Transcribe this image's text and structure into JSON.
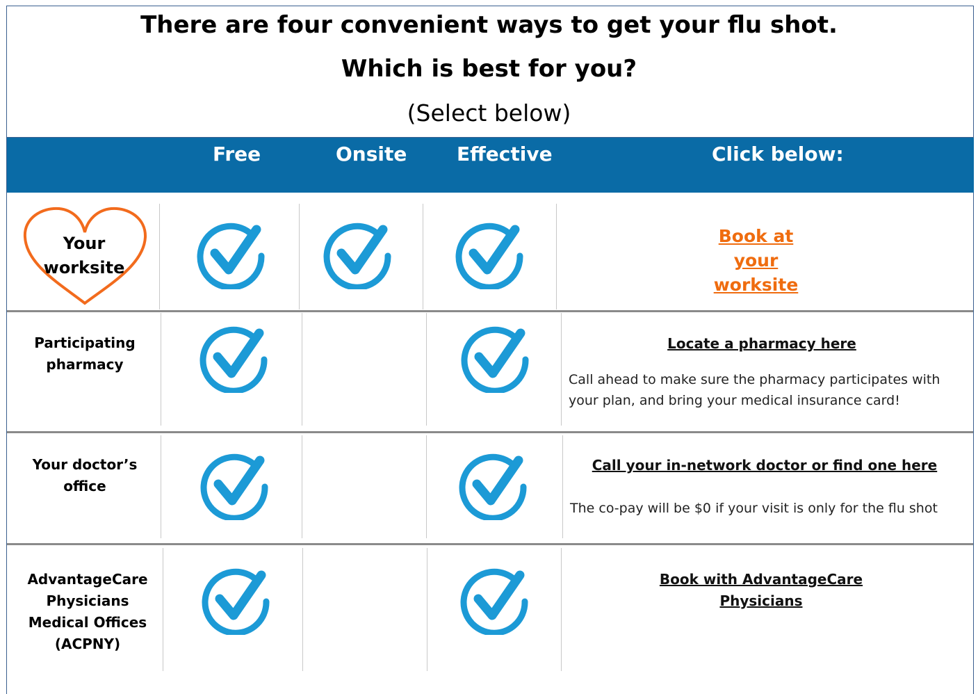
{
  "header": {
    "title_line1": "There are four convenient ways to get your flu shot.",
    "title_line2": "Which is best for you?",
    "subtitle": "(Select below)"
  },
  "columns": {
    "free": "Free",
    "onsite": "Onsite",
    "effective": "Effective",
    "click": "Click below:"
  },
  "rows": [
    {
      "label_line1": "Your",
      "label_line2": "worksite",
      "free": true,
      "onsite": true,
      "effective": true,
      "link_line1": "Book at",
      "link_line2": "your",
      "link_line3": "worksite"
    },
    {
      "label_line1": "Participating",
      "label_line2": "pharmacy",
      "free": true,
      "onsite": false,
      "effective": true,
      "link": "Locate a pharmacy here",
      "note_line1": "Call ahead to make sure the pharmacy participates with",
      "note_line2": "your plan, and bring your medical insurance card!"
    },
    {
      "label_line1": "Your doctor’s",
      "label_line2": "office",
      "free": true,
      "onsite": false,
      "effective": true,
      "link": "Call your in-network doctor or find one here",
      "note": "The co-pay will be $0 if your visit is only for the flu shot"
    },
    {
      "label_line1": "AdvantageCare",
      "label_line2": "Physicians",
      "label_line3": "Medical Offices",
      "label_line4": "(ACPNY)",
      "free": true,
      "onsite": false,
      "effective": true,
      "link_line1": "Book with AdvantageCare",
      "link_line2": "Physicians"
    }
  ],
  "colors": {
    "header_bar": "#0a6ba6",
    "check": "#1c9ad6",
    "heart": "#f26b1d",
    "link_orange": "#ef6c0f"
  },
  "icons": [
    "check-circle-icon",
    "heart-icon"
  ]
}
